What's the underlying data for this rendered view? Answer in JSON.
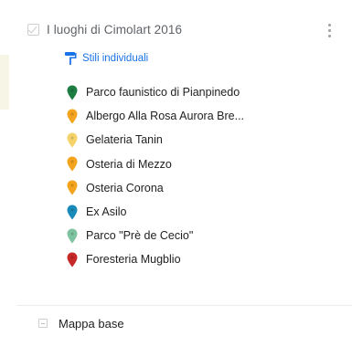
{
  "layer": {
    "title": "I luoghi di Cimolart 2016",
    "checked": true,
    "style_label": "Stili individuali",
    "style_icon": "paint-roller-icon",
    "more_icon": "more-vert-icon"
  },
  "places": [
    {
      "label": "Parco faunistico di Pianpinedo",
      "color": "#1e7d43"
    },
    {
      "label": "Albergo Alla Rosa Aurora Bre...",
      "color": "#f4a41c"
    },
    {
      "label": "Gelateria Tanin",
      "color": "#f6d36a"
    },
    {
      "label": "Osteria di Mezzo",
      "color": "#f4a41c"
    },
    {
      "label": "Osteria Corona",
      "color": "#f4a41c"
    },
    {
      "label": "Ex Asilo",
      "color": "#1a8bb8"
    },
    {
      "label": "Parco \"Prè de Cecio\"",
      "color": "#7dc3a0"
    },
    {
      "label": "Foresteria Mugblio",
      "color": "#c62828"
    }
  ],
  "base_map": {
    "label": "Mappa base"
  },
  "colors": {
    "accent": "#1a73e8"
  }
}
